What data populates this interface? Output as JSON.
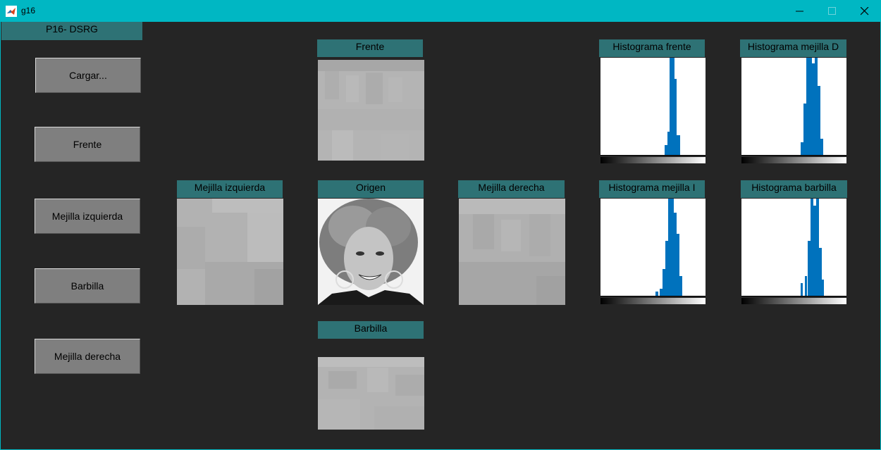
{
  "window": {
    "title": "g16"
  },
  "panel": {
    "title": "P16- DSRG"
  },
  "buttons": {
    "cargar": "Cargar...",
    "frente": "Frente",
    "mejilla_izq": "Mejilla izquierda",
    "barbilla": "Barbilla",
    "mejilla_der": "Mejilla derecha"
  },
  "images": {
    "frente": "Frente",
    "mejilla_izq": "Mejilla izquierda",
    "origen": "Origen",
    "mejilla_der": "Mejilla derecha",
    "barbilla": "Barbilla"
  },
  "histograms": {
    "frente": "Histograma frente",
    "mejilla_d": "Histograma mejilla D",
    "mejilla_i": "Histograma mejilla I",
    "barbilla": "Histograma barbilla"
  },
  "colors": {
    "accent": "#00b7c3",
    "header": "#2e7275",
    "bars": "#0072bd",
    "background": "#252525"
  }
}
